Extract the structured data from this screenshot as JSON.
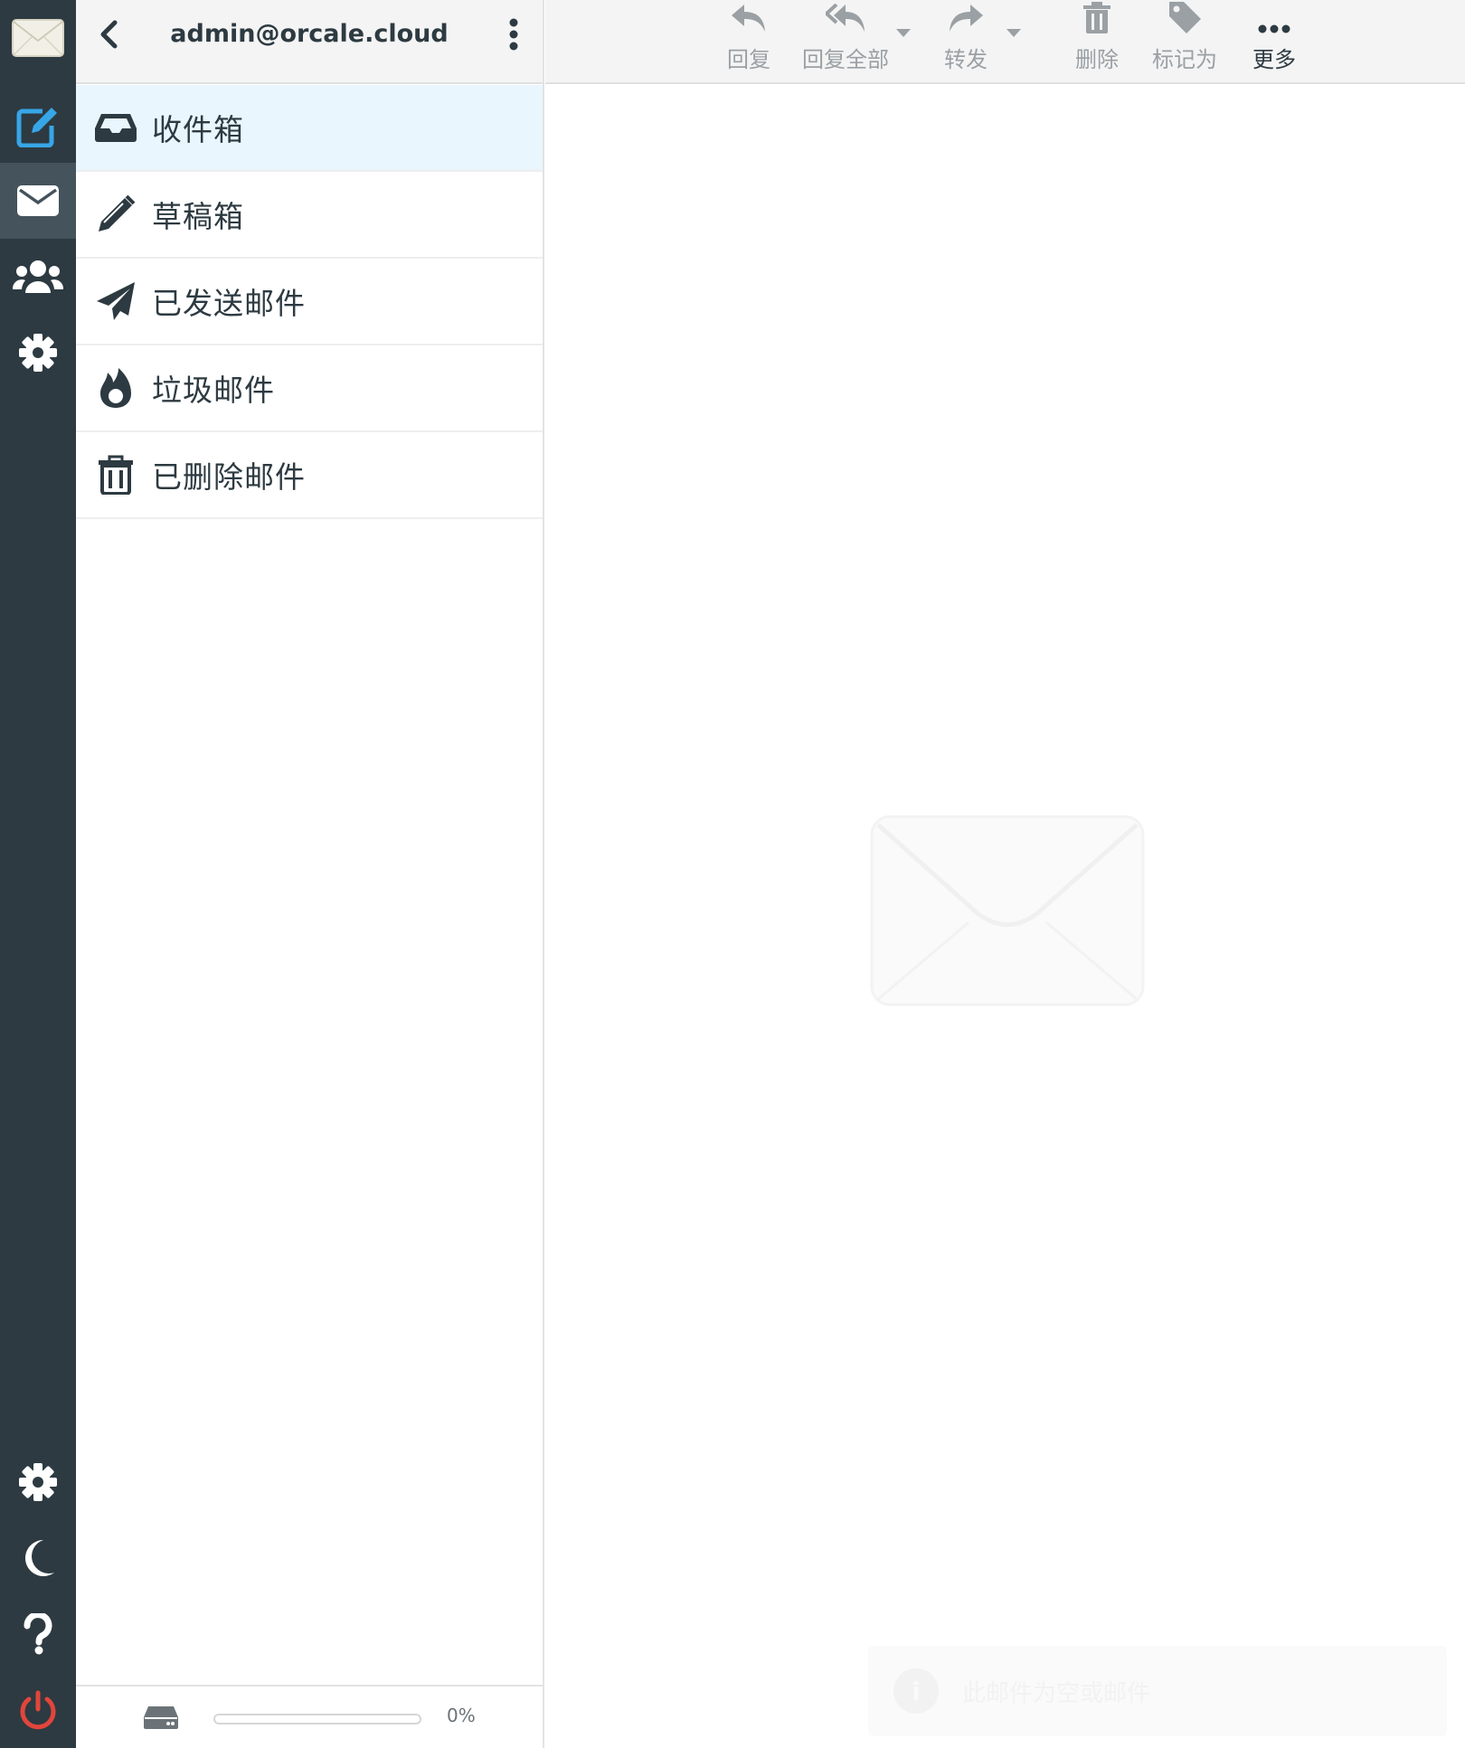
{
  "account": {
    "email": "admin@orcale.cloud"
  },
  "rail": {
    "items": [
      "logo-icon",
      "compose-icon",
      "mail-icon",
      "contacts-icon",
      "settings-icon"
    ],
    "bottom_items": [
      "settings-icon",
      "moon-icon",
      "help-icon",
      "power-icon"
    ],
    "accent_color": "#37a6e8",
    "logout_color": "#e2453c"
  },
  "folders": [
    {
      "label": "收件箱",
      "icon": "inbox-icon",
      "active": true
    },
    {
      "label": "草稿箱",
      "icon": "pencil-icon",
      "active": false
    },
    {
      "label": "已发送邮件",
      "icon": "paper-plane-icon",
      "active": false
    },
    {
      "label": "垃圾邮件",
      "icon": "fire-icon",
      "active": false
    },
    {
      "label": "已删除邮件",
      "icon": "trash-icon",
      "active": false
    }
  ],
  "quota": {
    "percent_text": "0%",
    "fraction": 0.0
  },
  "toolbar": {
    "reply": "回复",
    "reply_all": "回复全部",
    "forward": "转发",
    "delete": "删除",
    "mark_as": "标记为",
    "more": "更多"
  },
  "toast": {
    "message": "此邮件为空或邮件"
  }
}
